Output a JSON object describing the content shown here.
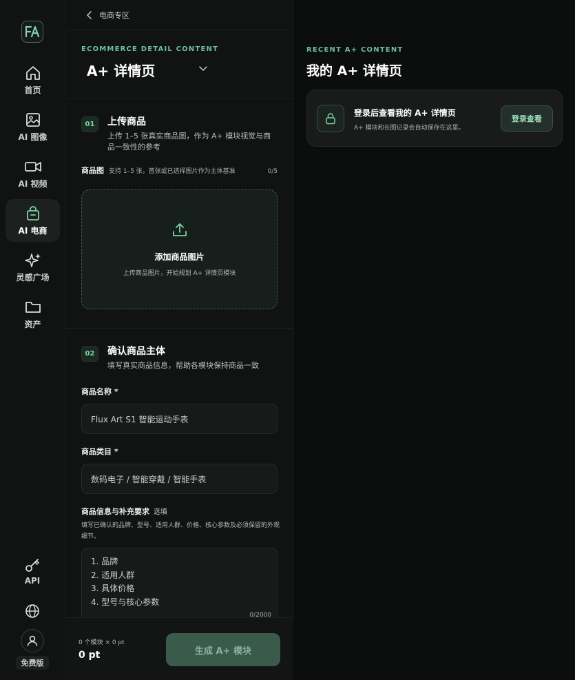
{
  "sidebar": {
    "logo_text": "FA",
    "items": [
      {
        "label": "首页",
        "icon": "home-icon"
      },
      {
        "label": "AI 图像",
        "icon": "image-icon"
      },
      {
        "label": "AI 视频",
        "icon": "video-icon"
      },
      {
        "label": "AI 电商",
        "icon": "shopping-bag-icon",
        "active": true
      },
      {
        "label": "灵感广场",
        "icon": "sparkle-icon"
      },
      {
        "label": "资产",
        "icon": "folder-icon"
      }
    ],
    "api_label": "API",
    "plan_label": "免费版"
  },
  "panel": {
    "breadcrumb": "电商专区",
    "eyebrow": "ECOMMERCE DETAIL CONTENT",
    "title": "A+ 详情页",
    "step1": {
      "num": "01",
      "title": "上传商品",
      "desc": "上传 1–5 张真实商品图，作为 A+ 模块视觉与商品一致性的参考",
      "field_label": "商品图",
      "field_hint": "支持 1–5 张，首张或已选择图片作为主体基准",
      "count": "0/5",
      "upload_title": "添加商品图片",
      "upload_sub": "上传商品图片，开始规划 A+ 详情页模块"
    },
    "step2": {
      "num": "02",
      "title": "确认商品主体",
      "desc": "填写真实商品信息，帮助各模块保持商品一致",
      "name_label": "商品名称 *",
      "name_value": "Flux Art S1 智能运动手表",
      "category_label": "商品类目 *",
      "category_value": "数码电子 / 智能穿戴 / 智能手表",
      "info_label": "商品信息与补充要求",
      "info_optional": "选填",
      "info_note": "填写已确认的品牌、型号、适用人群、价格、核心参数及必须保留的外观细节。",
      "info_lines": [
        "1. 品牌",
        "2. 适用人群",
        "3. 具体价格",
        "4. 型号与核心参数"
      ],
      "info_count": "0/2000"
    },
    "footer": {
      "meta": "0 个模块 × 0 pt",
      "points": "0 pt",
      "generate_label": "生成 A+ 模块"
    }
  },
  "recent": {
    "eyebrow": "RECENT A+ CONTENT",
    "title": "我的 A+ 详情页",
    "card_title": "登录后查看我的 A+ 详情页",
    "card_sub": "A+ 模块和长图记录会自动保存在这里。",
    "login_label": "登录查看"
  },
  "colors": {
    "accent": "#6fbf98",
    "background": "#0c0d0d",
    "panel": "#111313",
    "button_primary": "#3a5a4b"
  }
}
